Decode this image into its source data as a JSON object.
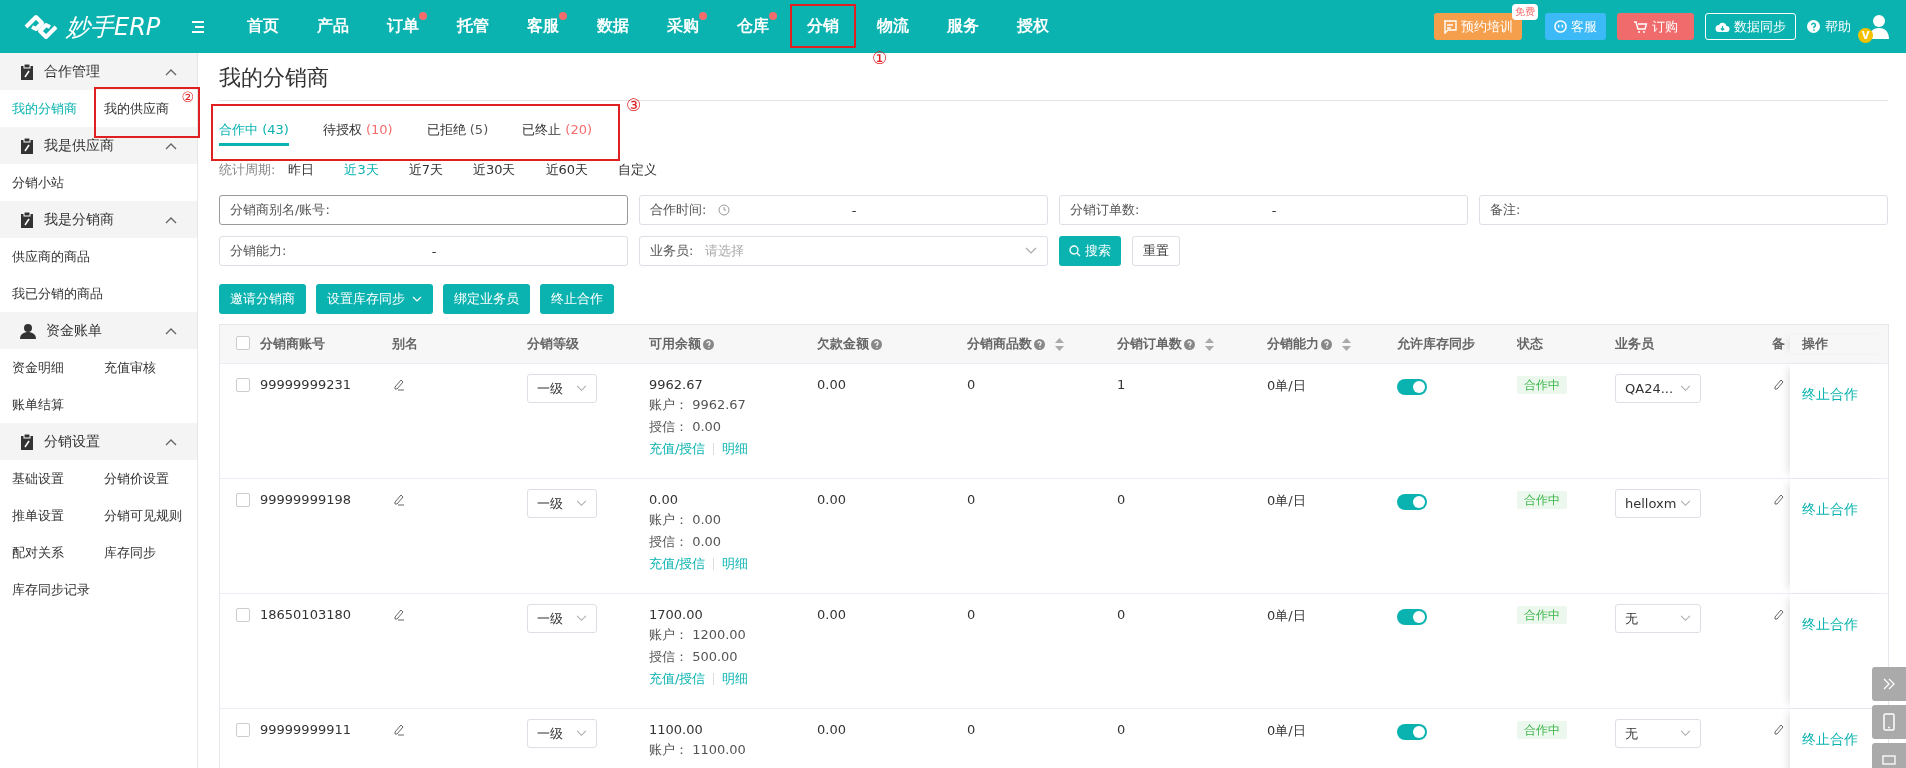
{
  "app": {
    "logo": "妙手ERP"
  },
  "nav": [
    {
      "label": "首页",
      "dot": false
    },
    {
      "label": "产品",
      "dot": false
    },
    {
      "label": "订单",
      "dot": true
    },
    {
      "label": "托管",
      "dot": false
    },
    {
      "label": "客服",
      "dot": true
    },
    {
      "label": "数据",
      "dot": false
    },
    {
      "label": "采购",
      "dot": true
    },
    {
      "label": "仓库",
      "dot": true
    },
    {
      "label": "分销",
      "dot": false,
      "annotation": "①"
    },
    {
      "label": "物流",
      "dot": false
    },
    {
      "label": "服务",
      "dot": false
    },
    {
      "label": "授权",
      "dot": false
    }
  ],
  "top_actions": [
    {
      "kind": "training",
      "label": "预约培训",
      "badge": "免费"
    },
    {
      "kind": "service",
      "label": "客服"
    },
    {
      "kind": "order",
      "label": "订购"
    },
    {
      "kind": "sync",
      "label": "数据同步"
    },
    {
      "kind": "help",
      "label": "帮助"
    },
    {
      "kind": "avatar",
      "badge": "V"
    }
  ],
  "sidebar": [
    {
      "title": "合作管理",
      "expanded": true,
      "rows": [
        [
          {
            "label": "我的分销商",
            "selected": true
          },
          {
            "label": "我的供应商",
            "selected": false,
            "annotation": "②"
          }
        ]
      ]
    },
    {
      "title": "我是供应商",
      "expanded": true,
      "rows": [
        [
          {
            "label": "分销小站",
            "selected": false
          }
        ]
      ]
    },
    {
      "title": "我是分销商",
      "expanded": true,
      "rows": [
        [
          {
            "label": "供应商的商品",
            "selected": false
          }
        ],
        [
          {
            "label": "我已分销的商品",
            "selected": false
          }
        ]
      ]
    },
    {
      "title": "资金账单",
      "expanded": true,
      "rows": [
        [
          {
            "label": "资金明细",
            "selected": false
          },
          {
            "label": "充值审核",
            "selected": false
          }
        ],
        [
          {
            "label": "账单结算",
            "selected": false
          }
        ]
      ]
    },
    {
      "title": "分销设置",
      "expanded": true,
      "rows": [
        [
          {
            "label": "基础设置",
            "selected": false
          },
          {
            "label": "分销价设置",
            "selected": false
          }
        ],
        [
          {
            "label": "推单设置",
            "selected": false
          },
          {
            "label": "分销可见规则",
            "selected": false
          }
        ],
        [
          {
            "label": "配对关系",
            "selected": false
          },
          {
            "label": "库存同步",
            "selected": false
          }
        ],
        [
          {
            "label": "库存同步记录",
            "selected": false
          }
        ]
      ]
    }
  ],
  "page_title": "我的分销商",
  "tabs_annotation": "③",
  "tabs": [
    {
      "label": "合作中",
      "count": "(43)",
      "color": "#0bb3b0",
      "selected": true
    },
    {
      "label": "待授权",
      "count": "(10)",
      "color": "#f56c6c",
      "selected": false
    },
    {
      "label": "已拒绝",
      "count": "(5)",
      "color": "#555555",
      "selected": false
    },
    {
      "label": "已终止",
      "count": "(20)",
      "color": "#f56c6c",
      "selected": false
    }
  ],
  "period": {
    "label": "统计周期:",
    "options": [
      {
        "label": "昨日",
        "selected": false
      },
      {
        "label": "近3天",
        "selected": true
      },
      {
        "label": "近7天",
        "selected": false
      },
      {
        "label": "近30天",
        "selected": false
      },
      {
        "label": "近60天",
        "selected": false
      },
      {
        "label": "自定义",
        "selected": false
      }
    ]
  },
  "filters": [
    {
      "kind": "text",
      "label": "分销商别名/账号:"
    },
    {
      "kind": "date-range",
      "label": "合作时间:",
      "separator": "-"
    },
    {
      "kind": "range",
      "label": "分销订单数:",
      "separator": "-"
    },
    {
      "kind": "text",
      "label": "备注:"
    },
    {
      "kind": "range",
      "label": "分销能力:",
      "separator": "-"
    },
    {
      "kind": "select",
      "label": "业务员:",
      "placeholder": "请选择"
    },
    {
      "kind": "search",
      "label": "搜索"
    },
    {
      "kind": "reset",
      "label": "重置"
    }
  ],
  "actions": [
    {
      "label": "邀请分销商",
      "dropdown": false
    },
    {
      "label": "设置库存同步",
      "dropdown": true
    },
    {
      "label": "绑定业务员",
      "dropdown": false
    },
    {
      "label": "终止合作",
      "dropdown": false
    }
  ],
  "table": {
    "select_all_checked": false,
    "columns": [
      "分销商账号",
      "别名",
      "分销等级",
      "可用余额",
      "欠款金额",
      "分销商品数",
      "分销订单数",
      "分销能力",
      "允许库存同步",
      "状态",
      "业务员",
      "备",
      "操作"
    ],
    "rows": [
      {
        "checked": false,
        "account": "99999999231",
        "level": "一级",
        "balance": "9962.67",
        "account_label": "账户：",
        "account_amount": "9962.67",
        "credit_label": "授信：",
        "credit_amount": "0.00",
        "links": [
          "充值/授信",
          "明细"
        ],
        "debt": "0.00",
        "goods": "0",
        "orders": "1",
        "ability": "0单/日",
        "sync": true,
        "status": "合作中",
        "salesman": "QA24...",
        "action": "终止合作"
      },
      {
        "checked": false,
        "account": "99999999198",
        "level": "一级",
        "balance": "0.00",
        "account_label": "账户：",
        "account_amount": "0.00",
        "credit_label": "授信：",
        "credit_amount": "0.00",
        "links": [
          "充值/授信",
          "明细"
        ],
        "debt": "0.00",
        "goods": "0",
        "orders": "0",
        "ability": "0单/日",
        "sync": true,
        "status": "合作中",
        "salesman": "helloxm",
        "action": "终止合作"
      },
      {
        "checked": false,
        "account": "18650103180",
        "level": "一级",
        "balance": "1700.00",
        "account_label": "账户：",
        "account_amount": "1200.00",
        "credit_label": "授信：",
        "credit_amount": "500.00",
        "links": [
          "充值/授信",
          "明细"
        ],
        "debt": "0.00",
        "goods": "0",
        "orders": "0",
        "ability": "0单/日",
        "sync": true,
        "status": "合作中",
        "salesman": "无",
        "action": "终止合作"
      },
      {
        "checked": false,
        "account": "99999999911",
        "level": "一级",
        "balance": "1100.00",
        "account_label": "账户：",
        "account_amount": "1100.00",
        "debt": "0.00",
        "goods": "0",
        "orders": "0",
        "ability": "0单/日",
        "sync": true,
        "status": "合作中",
        "salesman": "无",
        "action": "终止合作"
      }
    ]
  }
}
